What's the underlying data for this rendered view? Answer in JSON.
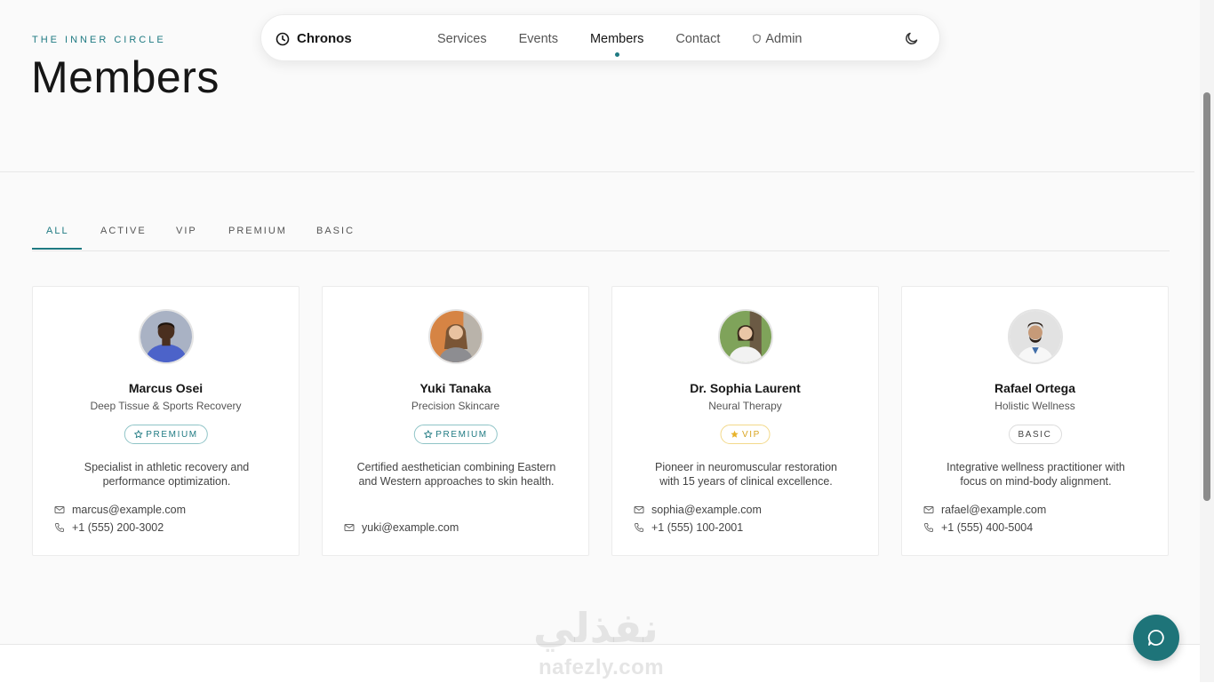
{
  "header": {
    "eyebrow": "THE INNER CIRCLE",
    "title": "Members"
  },
  "nav": {
    "brand": "Chronos",
    "links": [
      {
        "label": "Services",
        "active": false
      },
      {
        "label": "Events",
        "active": false
      },
      {
        "label": "Members",
        "active": true
      },
      {
        "label": "Contact",
        "active": false
      },
      {
        "label": "Admin",
        "active": false,
        "icon": "shield-icon"
      }
    ],
    "theme_icon": "moon-icon"
  },
  "tabs": [
    {
      "label": "ALL",
      "active": true
    },
    {
      "label": "ACTIVE",
      "active": false
    },
    {
      "label": "VIP",
      "active": false
    },
    {
      "label": "PREMIUM",
      "active": false
    },
    {
      "label": "BASIC",
      "active": false
    }
  ],
  "members": [
    {
      "name": "Marcus Osei",
      "role": "Deep Tissue & Sports Recovery",
      "tier": "PREMIUM",
      "description": "Specialist in athletic recovery and performance optimization.",
      "email": "marcus@example.com",
      "phone": "+1 (555) 200-3002"
    },
    {
      "name": "Yuki Tanaka",
      "role": "Precision Skincare",
      "tier": "PREMIUM",
      "description": "Certified aesthetician combining Eastern and Western approaches to skin health.",
      "email": "yuki@example.com"
    },
    {
      "name": "Dr. Sophia Laurent",
      "role": "Neural Therapy",
      "tier": "VIP",
      "description": "Pioneer in neuromuscular restoration with 15 years of clinical excellence.",
      "email": "sophia@example.com",
      "phone": "+1 (555) 100-2001"
    },
    {
      "name": "Rafael Ortega",
      "role": "Holistic Wellness",
      "tier": "BASIC",
      "description": "Integrative wellness practitioner with focus on mind-body alignment.",
      "email": "rafael@example.com",
      "phone": "+1 (555) 400-5004"
    }
  ],
  "watermark": {
    "arabic": "نفذلي",
    "latin": "nafezly.com"
  },
  "colors": {
    "accent": "#1f7a82",
    "vip": "#d9a521",
    "chat_button": "#1e7479"
  }
}
